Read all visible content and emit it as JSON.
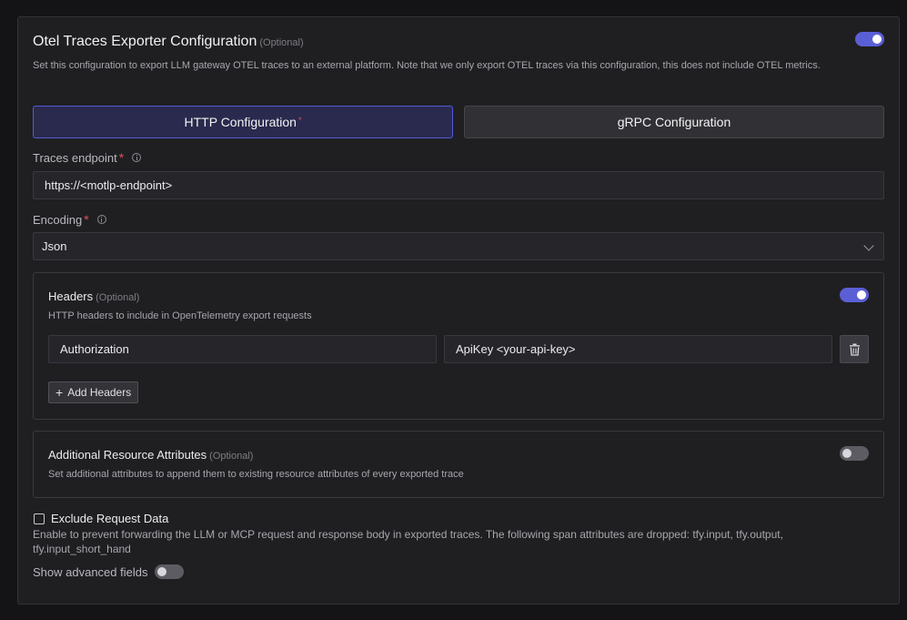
{
  "header": {
    "title": "Otel Traces Exporter Configuration",
    "optional": "(Optional)",
    "description": "Set this configuration to export LLM gateway OTEL traces to an external platform. Note that we only export OTEL traces via this configuration, this does not include OTEL metrics.",
    "enabled": true
  },
  "tabs": [
    {
      "label": "HTTP Configuration",
      "required_mark": "*",
      "active": true
    },
    {
      "label": "gRPC Configuration",
      "active": false
    }
  ],
  "traces_endpoint": {
    "label": "Traces endpoint",
    "required_mark": "*",
    "value": "https://<motlp-endpoint>"
  },
  "encoding": {
    "label": "Encoding",
    "required_mark": "*",
    "value": "Json"
  },
  "headers": {
    "title": "Headers",
    "optional": "(Optional)",
    "description": "HTTP headers to include in OpenTelemetry export requests",
    "enabled": true,
    "rows": [
      {
        "key": "Authorization",
        "value": "ApiKey <your-api-key>"
      }
    ],
    "add_label": "Add Headers"
  },
  "resource_attributes": {
    "title": "Additional Resource Attributes",
    "optional": "(Optional)",
    "description": "Set additional attributes to append them to existing resource attributes of every exported trace",
    "enabled": false
  },
  "exclude_request": {
    "label": "Exclude Request Data",
    "checked": false,
    "description": "Enable to prevent forwarding the LLM or MCP request and response body in exported traces. The following span attributes are dropped: tfy.input, tfy.output, tfy.input_short_hand"
  },
  "advanced": {
    "label": "Show advanced fields",
    "enabled": false
  },
  "colors": {
    "accent": "#5b5fd6",
    "required": "#e05060",
    "background": "#1f1f22"
  }
}
